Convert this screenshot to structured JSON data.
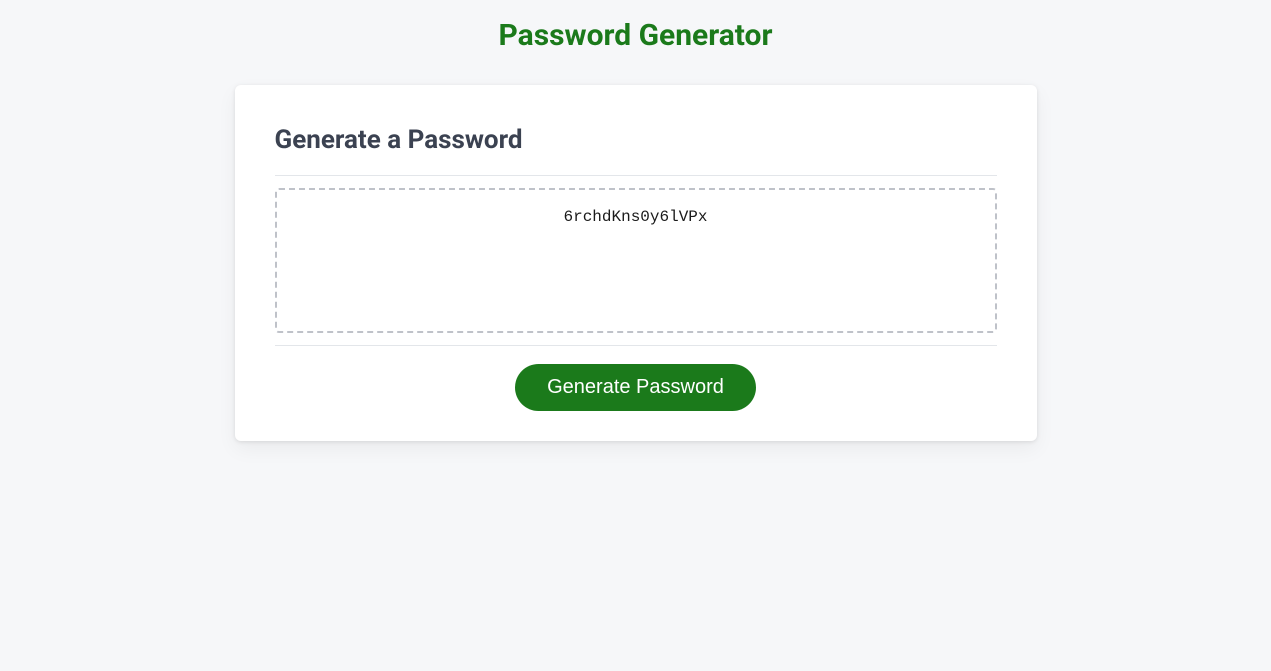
{
  "page": {
    "title": "Password Generator"
  },
  "card": {
    "header": "Generate a Password",
    "password_value": "6rchdKns0y6lVPx",
    "generate_button_label": "Generate Password"
  }
}
